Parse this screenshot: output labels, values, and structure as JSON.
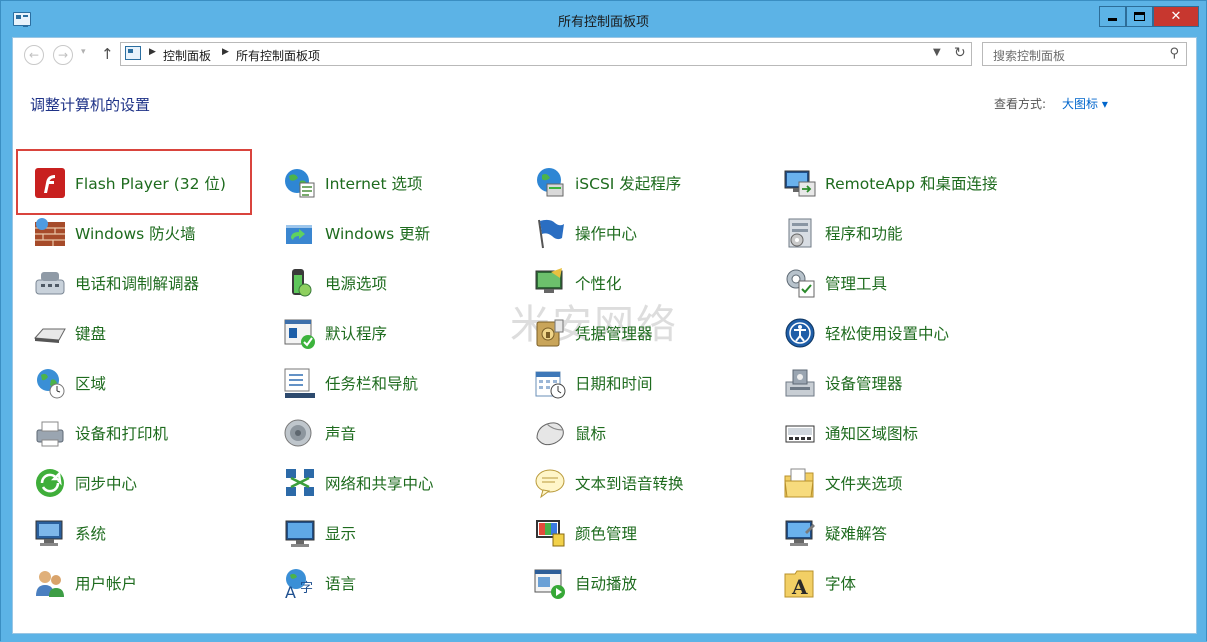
{
  "window": {
    "title": "所有控制面板项"
  },
  "address": {
    "crumb_root": "控制面板",
    "crumb_current": "所有控制面板项"
  },
  "search": {
    "placeholder": "搜索控制面板"
  },
  "page": {
    "heading": "调整计算机的设置",
    "view_label": "查看方式:",
    "view_value": "大图标 ▾"
  },
  "watermark": "米安网络",
  "columns": [
    {
      "items": [
        {
          "label": "Flash Player (32 位)",
          "icon": "flash-player-icon"
        },
        {
          "label": "Windows 防火墙",
          "icon": "firewall-icon"
        },
        {
          "label": "电话和调制解调器",
          "icon": "phone-modem-icon"
        },
        {
          "label": "键盘",
          "icon": "keyboard-icon"
        },
        {
          "label": "区域",
          "icon": "region-icon"
        },
        {
          "label": "设备和打印机",
          "icon": "printer-icon"
        },
        {
          "label": "同步中心",
          "icon": "sync-icon"
        },
        {
          "label": "系统",
          "icon": "system-icon"
        },
        {
          "label": "用户帐户",
          "icon": "users-icon"
        }
      ]
    },
    {
      "items": [
        {
          "label": "Internet 选项",
          "icon": "internet-options-icon"
        },
        {
          "label": "Windows 更新",
          "icon": "windows-update-icon"
        },
        {
          "label": "电源选项",
          "icon": "power-icon"
        },
        {
          "label": "默认程序",
          "icon": "default-programs-icon"
        },
        {
          "label": "任务栏和导航",
          "icon": "taskbar-icon"
        },
        {
          "label": "声音",
          "icon": "sound-icon"
        },
        {
          "label": "网络和共享中心",
          "icon": "network-icon"
        },
        {
          "label": "显示",
          "icon": "display-icon"
        },
        {
          "label": "语言",
          "icon": "language-icon"
        }
      ]
    },
    {
      "items": [
        {
          "label": "iSCSI 发起程序",
          "icon": "iscsi-icon"
        },
        {
          "label": "操作中心",
          "icon": "action-center-icon"
        },
        {
          "label": "个性化",
          "icon": "personalization-icon"
        },
        {
          "label": "凭据管理器",
          "icon": "credential-icon"
        },
        {
          "label": "日期和时间",
          "icon": "calendar-icon"
        },
        {
          "label": "鼠标",
          "icon": "mouse-icon"
        },
        {
          "label": "文本到语音转换",
          "icon": "speech-icon"
        },
        {
          "label": "颜色管理",
          "icon": "color-icon"
        },
        {
          "label": "自动播放",
          "icon": "autoplay-icon"
        }
      ]
    },
    {
      "items": [
        {
          "label": "RemoteApp 和桌面连接",
          "icon": "remoteapp-icon"
        },
        {
          "label": "程序和功能",
          "icon": "programs-icon"
        },
        {
          "label": "管理工具",
          "icon": "admin-tools-icon"
        },
        {
          "label": "轻松使用设置中心",
          "icon": "ease-of-access-icon"
        },
        {
          "label": "设备管理器",
          "icon": "device-manager-icon"
        },
        {
          "label": "通知区域图标",
          "icon": "notification-icon"
        },
        {
          "label": "文件夹选项",
          "icon": "folder-options-icon"
        },
        {
          "label": "疑难解答",
          "icon": "troubleshoot-icon"
        },
        {
          "label": "字体",
          "icon": "fonts-icon"
        }
      ]
    }
  ]
}
